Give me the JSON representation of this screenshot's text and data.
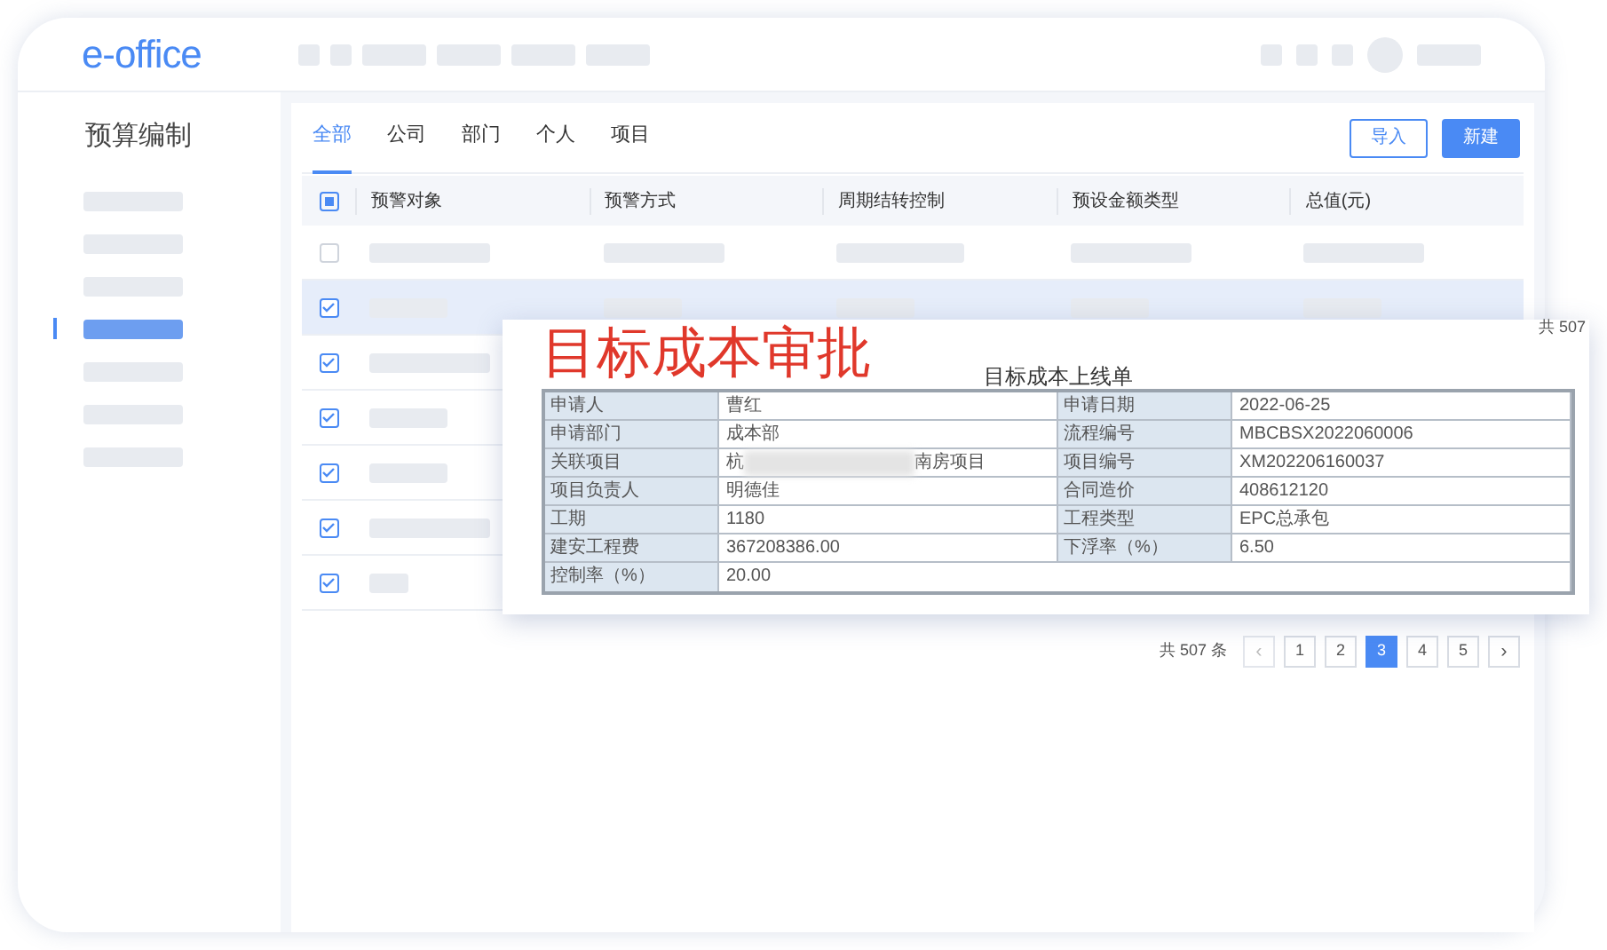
{
  "brand": {
    "logo": "e-office"
  },
  "topbar": {
    "nav_items": [
      {
        "selected": false
      },
      {
        "selected": false
      },
      {
        "selected": false
      },
      {
        "selected": false
      },
      {
        "selected": false
      },
      {
        "selected": false
      }
    ]
  },
  "sidebar": {
    "title": "预算编制",
    "items": [
      {
        "selected": false
      },
      {
        "selected": false
      },
      {
        "selected": false
      },
      {
        "selected": true
      },
      {
        "selected": false
      },
      {
        "selected": false
      },
      {
        "selected": false
      }
    ]
  },
  "tabs": [
    {
      "label": "全部",
      "selected": true
    },
    {
      "label": "公司",
      "selected": false
    },
    {
      "label": "部门",
      "selected": false
    },
    {
      "label": "个人",
      "selected": false
    },
    {
      "label": "项目",
      "selected": false
    }
  ],
  "actions": [
    {
      "label": "导入",
      "kind": "outline"
    },
    {
      "label": "新建",
      "kind": "primary"
    }
  ],
  "table": {
    "select_all_indeterminate": true,
    "columns": [
      "预警对象",
      "预警方式",
      "周期结转控制",
      "预设金额类型",
      "总值(元)"
    ],
    "rows": [
      {
        "checked": false,
        "selected": false
      },
      {
        "checked": true,
        "selected": true
      },
      {
        "checked": true,
        "selected": false
      },
      {
        "checked": true,
        "selected": false
      },
      {
        "checked": true,
        "selected": false
      },
      {
        "checked": true,
        "selected": false
      },
      {
        "checked": true,
        "selected": false
      }
    ]
  },
  "overlay": {
    "headline": "目标成本审批",
    "partial_total": "共 507",
    "form_title": "目标成本上线单",
    "form_rows": [
      [
        {
          "label": "申请人",
          "value": "曹红"
        },
        {
          "label": "申请日期",
          "value": "2022-06-25"
        }
      ],
      [
        {
          "label": "申请部门",
          "value": "成本部"
        },
        {
          "label": "流程编号",
          "value": "MBCBSX2022060006"
        }
      ],
      [
        {
          "label": "关联项目",
          "value": "杭",
          "value_end": "南房项目",
          "blurred": true
        },
        {
          "label": "项目编号",
          "value": "XM202206160037"
        }
      ],
      [
        {
          "label": "项目负责人",
          "value": "明德佳"
        },
        {
          "label": "合同造价",
          "value": "408612120"
        }
      ],
      [
        {
          "label": "工期",
          "value": "1180"
        },
        {
          "label": "工程类型",
          "value": "EPC总承包"
        }
      ],
      [
        {
          "label": "建安工程费",
          "value": "367208386.00"
        },
        {
          "label": "下浮率（%）",
          "value": "6.50"
        }
      ],
      [
        {
          "label": "控制率（%）",
          "value": "20.00"
        }
      ]
    ]
  },
  "pagination": {
    "total": "共 507 条",
    "prev": "‹",
    "next": "›",
    "pages": [
      {
        "label": "1",
        "selected": false
      },
      {
        "label": "2",
        "selected": false
      },
      {
        "label": "3",
        "selected": true
      },
      {
        "label": "4",
        "selected": false
      },
      {
        "label": "5",
        "selected": false
      }
    ]
  }
}
